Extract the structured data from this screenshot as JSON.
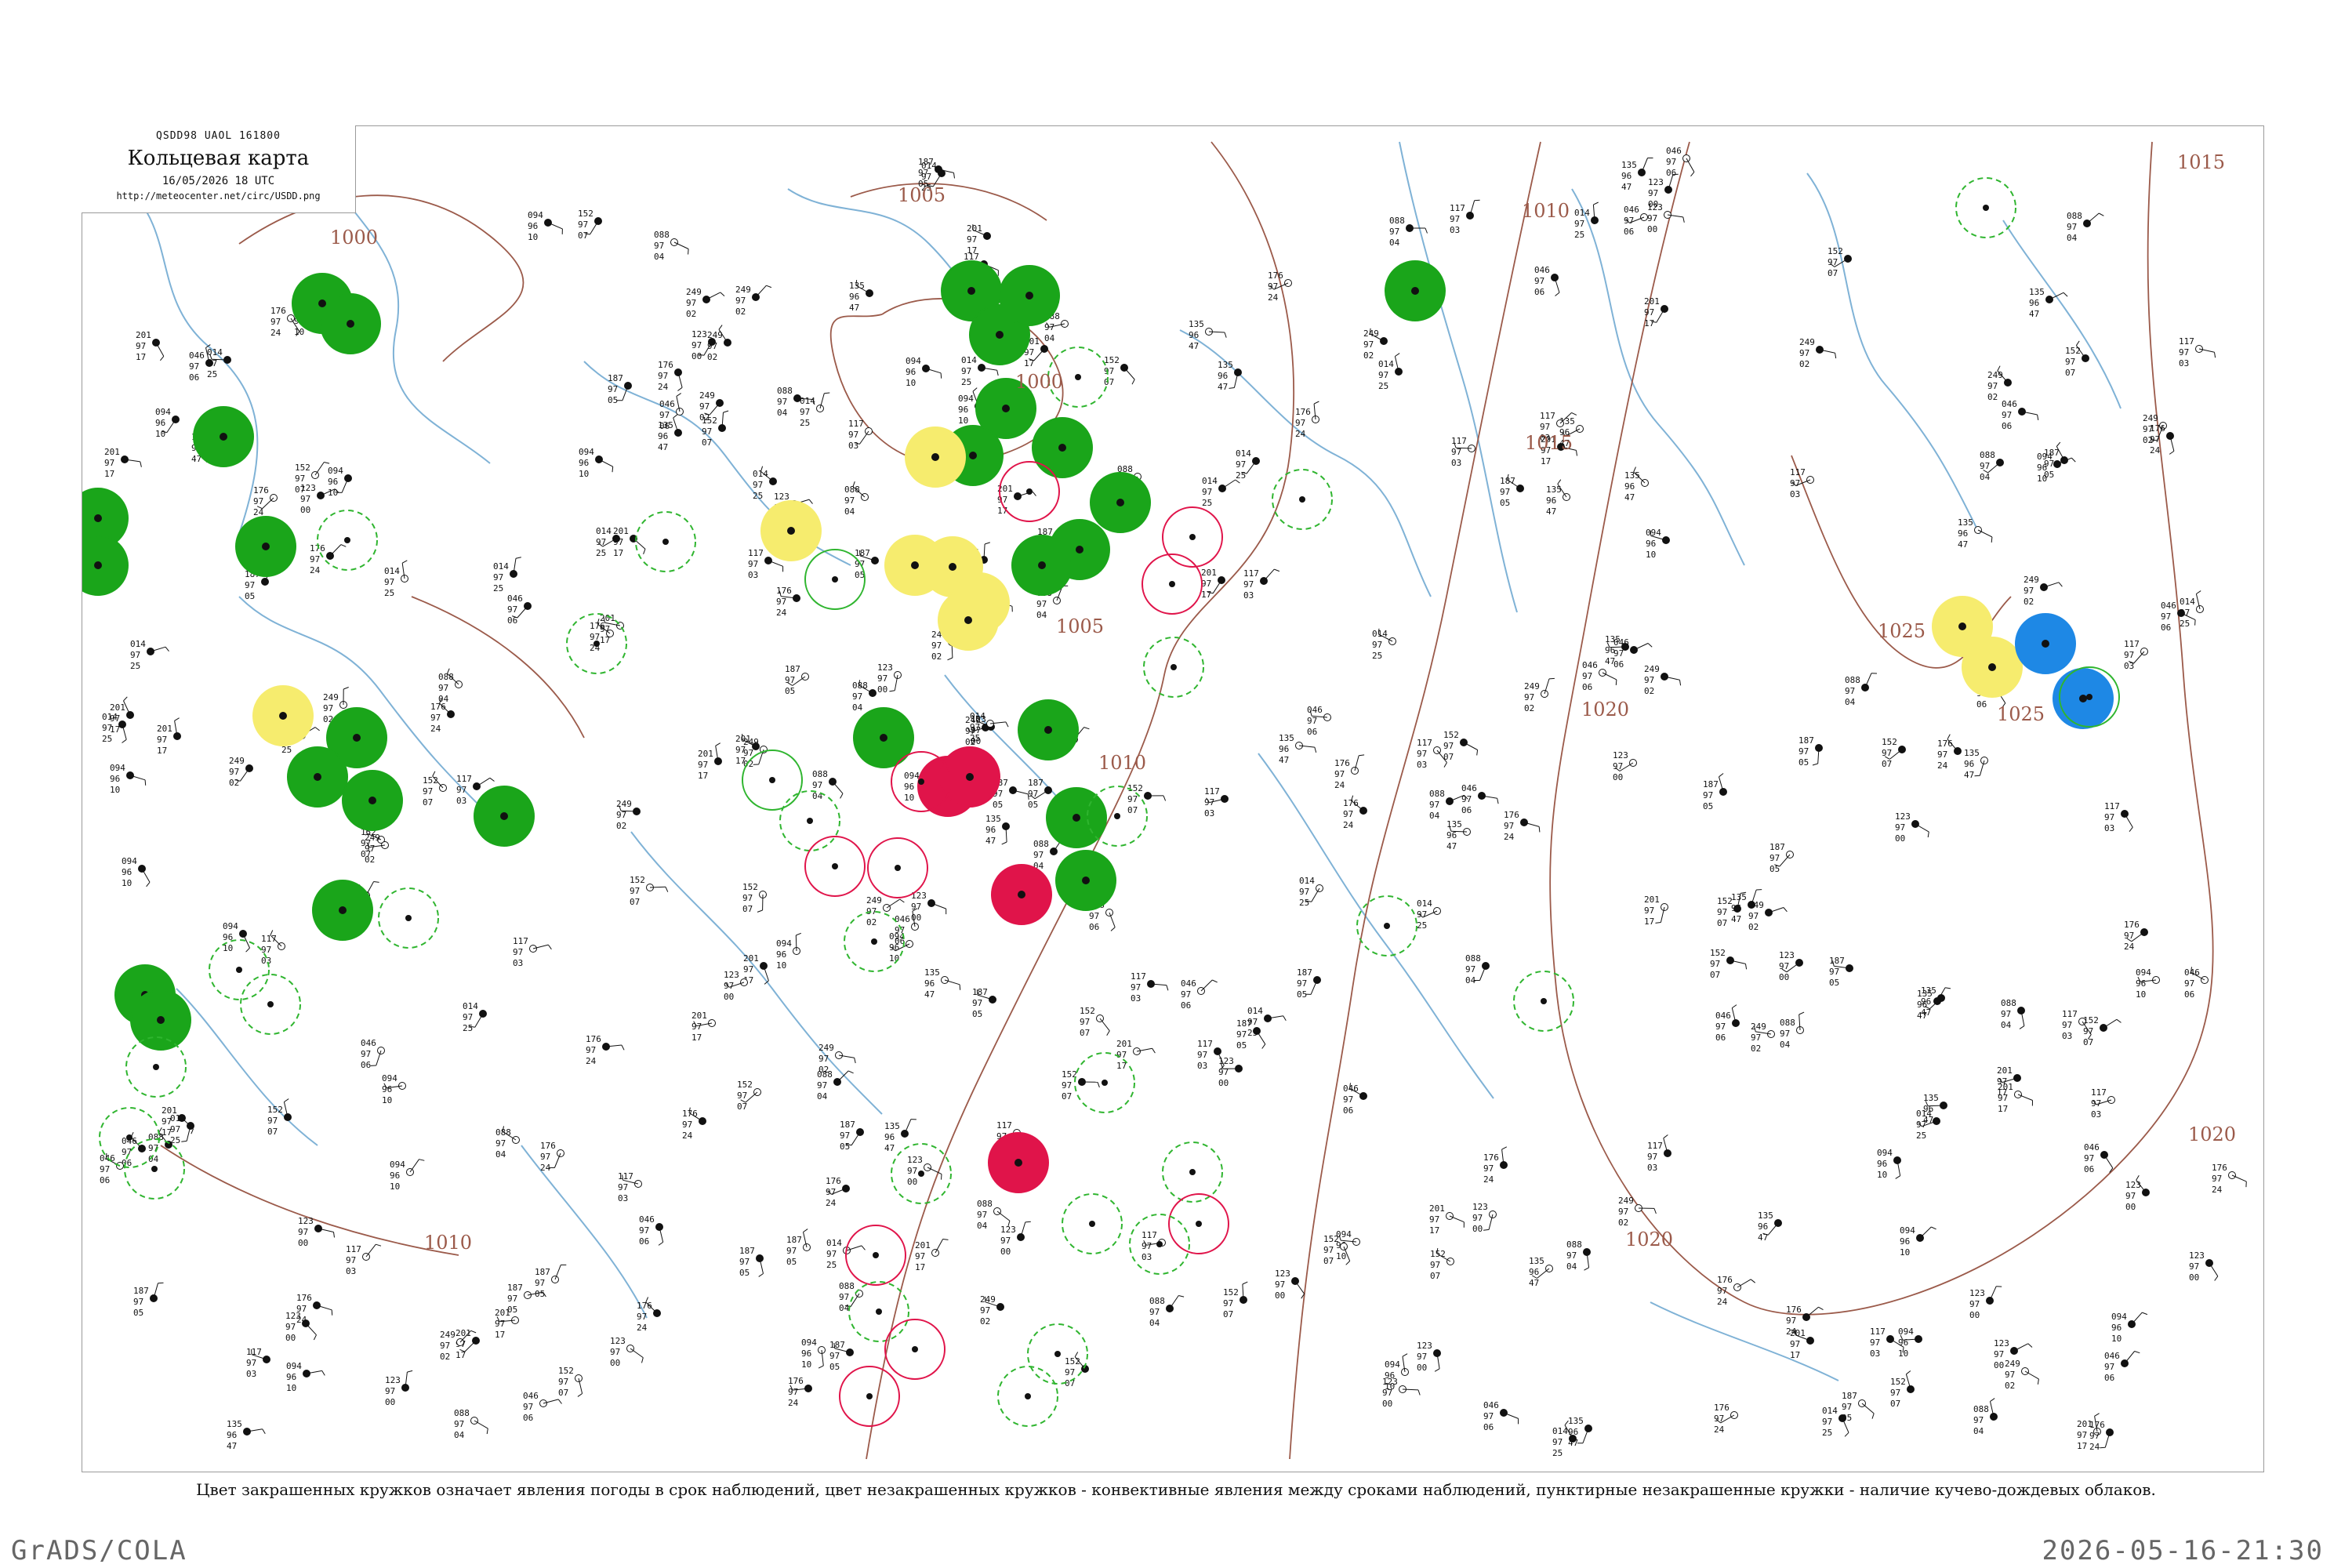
{
  "title": {
    "code": "QSDD98  UAOL  161800",
    "name": "Кольцевая карта",
    "date": "16/05/2026 18 UTC",
    "url": "http://meteocenter.net/circ/USDD.png"
  },
  "caption": "Цвет закрашенных кружков означает явления погоды в срок наблюдений, цвет незакрашенных кружков - конвективные явления между сроками наблюдений, пунктирные незакрашенные кружки - наличие кучево-дождевых облаков.",
  "footer": {
    "left": "GrADS/COLA",
    "right": "2026-05-16-21:30"
  },
  "colors": {
    "isobar": "#9b5a4a",
    "river": "#7fb2d6",
    "border": "#9a9a9a",
    "filled_green": "#1aa51a",
    "filled_yellow": "#f6ec6e",
    "filled_red": "#e0144a",
    "filled_blue": "#1e88e5",
    "ring_green": "#2fb52f",
    "ring_red": "#e0144a"
  },
  "isobars": [
    {
      "label": "1000"
    },
    {
      "label": "1005"
    },
    {
      "label": "1010"
    },
    {
      "label": "1015"
    },
    {
      "label": "1020"
    },
    {
      "label": "1025"
    }
  ],
  "station_samples": [
    {
      "t": "123",
      "p": "97",
      "d": "00"
    },
    {
      "t": "046",
      "p": "97",
      "d": "06"
    },
    {
      "t": "152",
      "p": "97",
      "d": "07"
    },
    {
      "t": "014",
      "p": "97",
      "d": "25"
    },
    {
      "t": "117",
      "p": "97",
      "d": "03"
    },
    {
      "t": "176",
      "p": "97",
      "d": "24"
    },
    {
      "t": "094",
      "p": "96",
      "d": "10"
    },
    {
      "t": "201",
      "p": "97",
      "d": "17"
    },
    {
      "t": "249",
      "p": "97",
      "d": "02"
    },
    {
      "t": "088",
      "p": "97",
      "d": "04"
    },
    {
      "t": "135",
      "p": "96",
      "d": "47"
    },
    {
      "t": "187",
      "p": "97",
      "d": "05"
    }
  ]
}
